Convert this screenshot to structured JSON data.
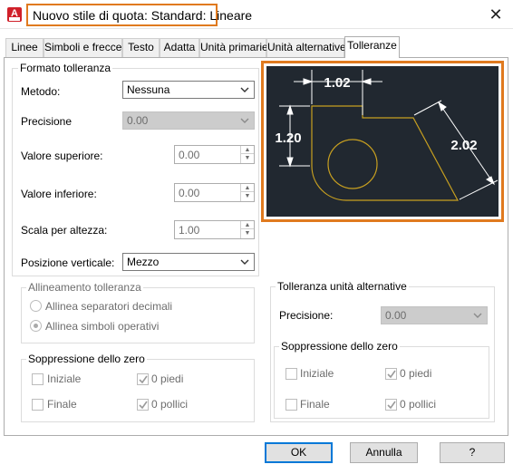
{
  "window": {
    "title": "Nuovo stile di quota: Standard: Lineare",
    "close_glyph": "✕",
    "app_icon_letter": "A"
  },
  "tabs": [
    {
      "label": "Linee",
      "active": false
    },
    {
      "label": "Simboli e frecce",
      "active": false
    },
    {
      "label": "Testo",
      "active": false
    },
    {
      "label": "Adatta",
      "active": false
    },
    {
      "label": "Unità primarie",
      "active": false
    },
    {
      "label": "Unità alternative",
      "active": false
    },
    {
      "label": "Tolleranze",
      "active": true
    }
  ],
  "tolerance_format": {
    "title": "Formato tolleranza",
    "method_label": "Metodo:",
    "method_value": "Nessuna",
    "precision_label": "Precisione",
    "precision_value": "0.00",
    "upper_label": "Valore superiore:",
    "upper_value": "0.00",
    "lower_label": "Valore inferiore:",
    "lower_value": "0.00",
    "height_scale_label": "Scala per altezza:",
    "height_scale_value": "1.00",
    "vertical_position_label": "Posizione verticale:",
    "vertical_position_value": "Mezzo"
  },
  "alignment": {
    "title": "Allineamento tolleranza",
    "option_decimal": "Allinea separatori decimali",
    "option_symbols": "Allinea simboli operativi",
    "selected": "symbols"
  },
  "zero_suppression_primary": {
    "title": "Soppressione dello zero",
    "leading": "Iniziale",
    "trailing": "Finale",
    "feet": "0 piedi",
    "inches": "0 pollici",
    "leading_checked": false,
    "trailing_checked": false,
    "feet_checked": true,
    "inches_checked": true
  },
  "alt_tolerance": {
    "title": "Tolleranza unità alternative",
    "precision_label": "Precisione:",
    "precision_value": "0.00"
  },
  "zero_suppression_alt": {
    "title": "Soppressione dello zero",
    "leading": "Iniziale",
    "trailing": "Finale",
    "feet": "0 piedi",
    "inches": "0 pollici",
    "leading_checked": false,
    "trailing_checked": false,
    "feet_checked": true,
    "inches_checked": true
  },
  "preview": {
    "dim_top": "1.02",
    "dim_left": "1.20",
    "dim_diag": "2.02",
    "background_color": "#212830",
    "geometry_color": "#c8a020",
    "dimension_color": "#ffffff",
    "highlight_color": "#e07a1f"
  },
  "buttons": {
    "ok": "OK",
    "cancel": "Annulla",
    "help": "?"
  }
}
